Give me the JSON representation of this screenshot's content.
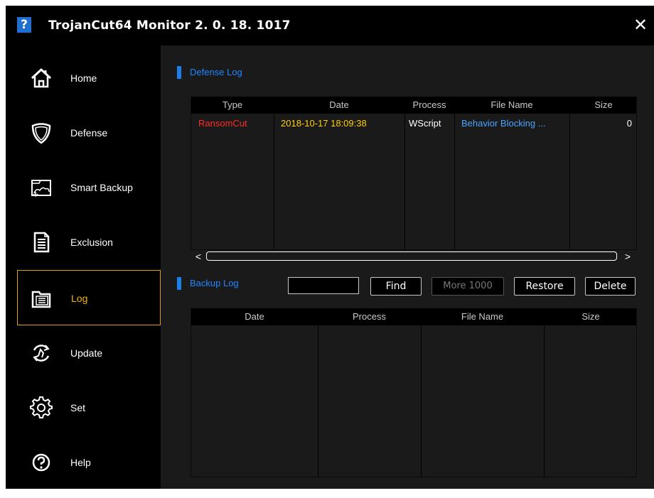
{
  "window": {
    "app_icon_glyph": "?",
    "title": "TrojanCut64 Monitor 2. 0. 18. 1017",
    "close_glyph": "✕"
  },
  "sidebar": {
    "items": [
      {
        "label": "Home",
        "icon": "home-icon",
        "active": false
      },
      {
        "label": "Defense",
        "icon": "shield-icon",
        "active": false
      },
      {
        "label": "Smart Backup",
        "icon": "backup-icon",
        "active": false
      },
      {
        "label": "Exclusion",
        "icon": "document-icon",
        "active": false
      },
      {
        "label": "Log",
        "icon": "log-folder-icon",
        "active": true
      },
      {
        "label": "Update",
        "icon": "update-icon",
        "active": false
      },
      {
        "label": "Set",
        "icon": "gear-icon",
        "active": false
      },
      {
        "label": "Help",
        "icon": "help-icon",
        "active": false
      }
    ]
  },
  "defense_log": {
    "title": "Defense Log",
    "columns": [
      "Type",
      "Date",
      "Process",
      "File Name",
      "Size"
    ],
    "rows": [
      {
        "type": "RansomCut",
        "date": "2018-10-17 18:09:38",
        "process": "WScript",
        "file_name": "Behavior Blocking ...",
        "size": "0"
      }
    ],
    "scroll_left": "<",
    "scroll_right": ">"
  },
  "backup_log": {
    "title": "Backup Log",
    "search_value": "",
    "find_label": "Find",
    "more_label": "More 1000",
    "restore_label": "Restore",
    "delete_label": "Delete",
    "columns": [
      "Date",
      "Process",
      "File Name",
      "Size"
    ],
    "rows": []
  },
  "colors": {
    "accent_blue": "#1f86ff",
    "active_gold": "#f5b400",
    "type_red": "#ff2a2a",
    "date_yellow": "#ffd000",
    "filename_blue": "#4aa3ff"
  }
}
